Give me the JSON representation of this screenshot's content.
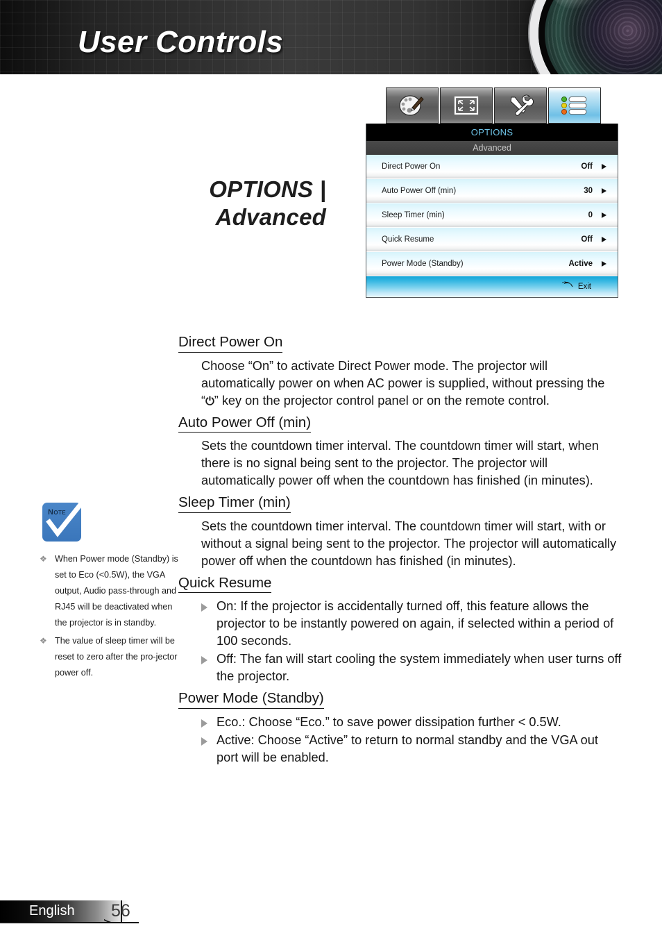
{
  "header": {
    "title": "User Controls"
  },
  "page_title": {
    "line1": "OPTIONS |",
    "line2": "Advanced"
  },
  "osd": {
    "tabs": [
      {
        "name": "image-tab",
        "icon": "palette-icon",
        "active": false
      },
      {
        "name": "display-tab",
        "icon": "screen-icon",
        "active": false
      },
      {
        "name": "setup-tab",
        "icon": "tools-icon",
        "active": false
      },
      {
        "name": "options-tab",
        "icon": "options-list-icon",
        "active": true
      }
    ],
    "header": "OPTIONS",
    "subheader": "Advanced",
    "rows": [
      {
        "label": "Direct Power On",
        "value": "Off"
      },
      {
        "label": "Auto Power Off (min)",
        "value": "30"
      },
      {
        "label": "Sleep Timer (min)",
        "value": "0"
      },
      {
        "label": "Quick Resume",
        "value": "Off"
      },
      {
        "label": "Power Mode (Standby)",
        "value": "Active"
      }
    ],
    "exit": "Exit",
    "colors": {
      "header_text": "#6fc4e8",
      "exit_bar": "#13a5d8",
      "row_top": "#d6f3fb"
    }
  },
  "note": {
    "icon_label": "Note",
    "items": [
      "When Power mode (Standby) is set to Eco (<0.5W), the VGA output, Audio pass-through and RJ45 will be deactivated when the projector is in standby.",
      "The value of sleep timer will be reset to zero after the  pro-jector power off."
    ],
    "bullet_glyph": "❖"
  },
  "content": {
    "sections": [
      {
        "heading": "Direct Power On",
        "body_before": "Choose “On” to activate Direct Power mode. The projector will automatically power on when AC power is supplied, without pressing the “",
        "power_glyph": "⏻",
        "body_after": "” key on the projector control panel or on the remote control.",
        "bullets": []
      },
      {
        "heading": "Auto Power Off (min)",
        "body": "Sets the countdown timer interval. The countdown timer will start, when there is no signal being sent to the projector. The projector will automatically power off when the countdown has finished (in minutes).",
        "bullets": []
      },
      {
        "heading": "Sleep Timer (min)",
        "body": "Sets the countdown timer interval. The countdown timer will start, with or without a signal being sent to the projector. The projector will automatically power off when the countdown has finished (in minutes).",
        "bullets": []
      },
      {
        "heading": "Quick Resume",
        "body": "",
        "bullets": [
          "On: If the projector is accidentally turned off, this feature allows the projector to be instantly powered on again, if selected within a period of 100 seconds.",
          "Off: The fan will start cooling the system immediately when user turns off the projector."
        ]
      },
      {
        "heading": "Power Mode (Standby)",
        "body": "",
        "bullets": [
          "Eco.: Choose “Eco.” to save power dissipation further < 0.5W.",
          "Active: Choose “Active” to return to normal standby and the VGA out port will be enabled."
        ]
      }
    ]
  },
  "footer": {
    "language": "English",
    "page_number": "56"
  }
}
